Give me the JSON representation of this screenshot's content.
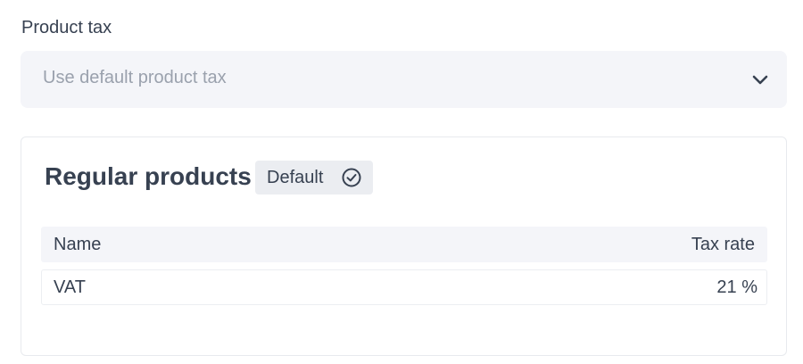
{
  "product_tax": {
    "label": "Product tax",
    "select": {
      "value": "Use default product tax"
    }
  },
  "card": {
    "title": "Regular products",
    "badge": "Default",
    "table": {
      "columns": [
        "Name",
        "Tax rate"
      ],
      "rows": [
        {
          "name": "VAT",
          "rate": "21 %"
        }
      ]
    }
  },
  "colors": {
    "text": "#374151",
    "placeholder": "#9aa1ad",
    "select_bg": "#f4f5f9",
    "badge_bg": "#ebedf1",
    "border": "#e8eaee"
  },
  "icons": {
    "select": "chevron-down-icon",
    "badge": "check-circle-icon"
  }
}
